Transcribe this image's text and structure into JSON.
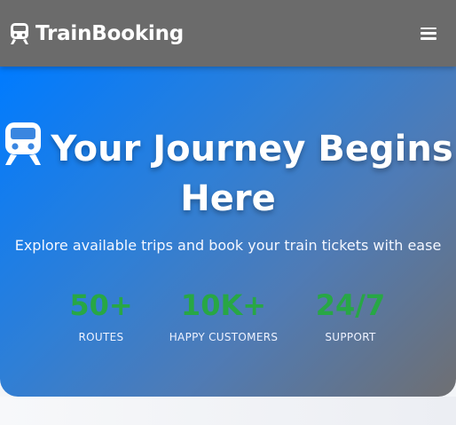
{
  "navbar": {
    "brand": "TrainBooking",
    "brand_icon": "train-icon",
    "menu_icon": "hamburger-menu-icon"
  },
  "hero": {
    "title": "Your Journey Begins Here",
    "title_icon": "train-icon",
    "subtitle": "Explore available trips and book your train tickets with ease",
    "stats": [
      {
        "value": "50+",
        "label": "Routes"
      },
      {
        "value": "10K+",
        "label": "Happy Customers"
      },
      {
        "value": "24/7",
        "label": "Support"
      }
    ]
  },
  "colors": {
    "navbar_bg": "#6b6b6b",
    "hero_gradient_start": "#007bff",
    "hero_gradient_end": "#6f6f72",
    "stat_value": "#28a745"
  }
}
